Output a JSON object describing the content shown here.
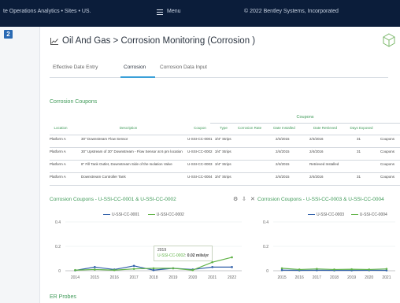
{
  "topbar": {
    "left_text": "te Operations Analytics • Sites • US.",
    "menu_label": "Menu",
    "right_text": "© 2022 Bentley Systems, Incorporated"
  },
  "page": {
    "title": "Oil And Gas > Corrosion Monitoring (Corrosion )"
  },
  "tabs": [
    {
      "label": "Effective Date Entry"
    },
    {
      "label": "Corrosion"
    },
    {
      "label": "Corrosion Data Input"
    }
  ],
  "coupons": {
    "section_title": "Corrosion Coupons",
    "group_label": "Coupons",
    "columns": [
      "Location",
      "Description",
      "Coupon",
      "Type",
      "Corrosion Rate",
      "Date Installed",
      "Date Retrieved",
      "Days Exposed",
      ""
    ],
    "rows": [
      [
        "Platform A",
        "30\" Downstream Flow Sensor",
        "U-SSI-CC-0001",
        "3/4\" Strips",
        "",
        "2/4/2015",
        "2/4/2016",
        "31",
        "Coupons"
      ],
      [
        "Platform A",
        "30\" Upstream of 30\" Downstream - Flow Sensor at 6 pm location",
        "U-SSI-CC-0002",
        "3/4\" Strips",
        "",
        "2/4/2015",
        "2/4/2016",
        "31",
        "Coupons"
      ],
      [
        "Platform A",
        "8\" Fill Tank Outlet, Downstream Side of the Isolation Valve",
        "U-SSI-CC-0003",
        "3/4\" Strips",
        "",
        "2/4/2015",
        "Retrieved Installed",
        "",
        "Coupons"
      ],
      [
        "Platform A",
        "Downstream Controller Tank",
        "U-SSI-CC-0004",
        "3/4\" Strips",
        "",
        "2/4/2015",
        "2/4/2016",
        "31",
        "Coupons"
      ]
    ]
  },
  "chart_left": {
    "title": "Corrosion Coupons - U-SSI-CC-0001 & U-SSI-CC-0002",
    "tooltip_year": "2019",
    "tooltip_series": "U-SSI-CC-0002",
    "tooltip_value": "0.02 mils/yr"
  },
  "chart_right": {
    "title": "Corrosion Coupons - U-SSI-CC-0003 & U-SSI-CC-0004"
  },
  "bottom_section": "ER Probes",
  "colors": {
    "blue": "#2e5ea8",
    "green": "#5fb246",
    "accent": "#3aa0d8",
    "nav": "#0b1d3a"
  },
  "chart_data": [
    {
      "type": "line",
      "title": "Corrosion Coupons - U-SSI-CC-0001 & U-SSI-CC-0002",
      "x": [
        "2014",
        "2015",
        "2016",
        "2017",
        "2018",
        "2019",
        "2020",
        "2021",
        "2022"
      ],
      "series": [
        {
          "name": "U-SSI-CC-0001",
          "color": "#2e5ea8",
          "values": [
            0.003,
            0.03,
            0.01,
            0.04,
            0.005,
            0.02,
            0.01,
            0.03,
            0.03
          ]
        },
        {
          "name": "U-SSI-CC-0002",
          "color": "#5fb246",
          "values": [
            0.005,
            0.01,
            0.005,
            0.015,
            0.02,
            0.02,
            0.005,
            0.07,
            0.11
          ]
        }
      ],
      "yticks": [
        "0",
        "0.2",
        "0.4"
      ],
      "ylim": [
        0,
        0.4
      ],
      "legend": "top-center"
    },
    {
      "type": "line",
      "title": "Corrosion Coupons - U-SSI-CC-0003 & U-SSI-CC-0004",
      "x": [
        "2015",
        "2016",
        "2017",
        "2018",
        "2019",
        "2020",
        "2021"
      ],
      "series": [
        {
          "name": "U-SSI-CC-0003",
          "color": "#2e5ea8",
          "values": [
            0.005,
            0.003,
            0.004,
            0.003,
            0.003,
            0.004,
            0.003
          ]
        },
        {
          "name": "U-SSI-CC-0004",
          "color": "#5fb246",
          "values": [
            0.02,
            0.01,
            0.015,
            0.01,
            0.012,
            0.01,
            0.015
          ]
        }
      ],
      "yticks": [
        "0",
        "0.2",
        "0.4"
      ],
      "ylim": [
        0,
        0.4
      ],
      "legend": "top-center"
    }
  ]
}
